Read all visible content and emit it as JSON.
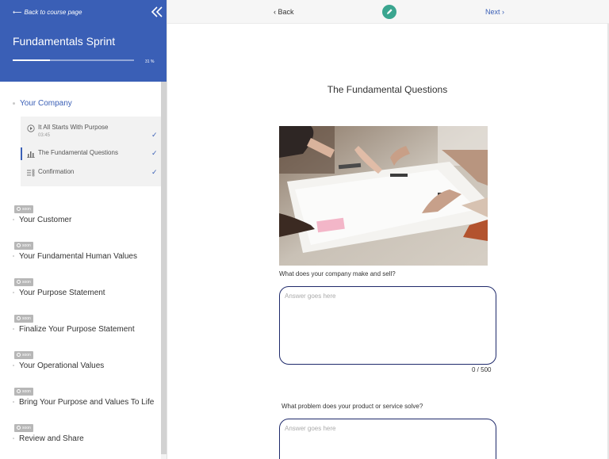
{
  "sidebar": {
    "back_link": "Back to course page",
    "course_title": "Fundamentals Sprint",
    "progress_text": "31 %",
    "progress_value": 0.31,
    "active_module": "Your Company",
    "lessons": [
      {
        "label": "It All Starts With Purpose",
        "sublabel": "03:45",
        "icon": "play-circle-icon"
      },
      {
        "label": "The Fundamental Questions",
        "icon": "bar-chart-icon"
      },
      {
        "label": "Confirmation",
        "icon": "checklist-icon"
      }
    ],
    "soon_label": "soon",
    "upcoming_modules": [
      "Your Customer",
      "Your Fundamental Human Values",
      "Your Purpose Statement",
      "Finalize Your Purpose Statement",
      "Your Operational Values",
      "Bring Your Purpose and Values To Life",
      "Review and Share"
    ]
  },
  "topbar": {
    "back": "Back",
    "next": "Next"
  },
  "main": {
    "title": "The Fundamental Questions",
    "questions": [
      {
        "label": "What does your company make and sell?",
        "placeholder": "Answer goes here",
        "counter": "0 / 500"
      },
      {
        "label": "What problem does your product or service solve?",
        "placeholder": "Answer goes here"
      }
    ]
  },
  "colors": {
    "brand": "#3a5fb6",
    "edit_button": "#3aa58f",
    "textarea_border": "#1f2a6b"
  }
}
